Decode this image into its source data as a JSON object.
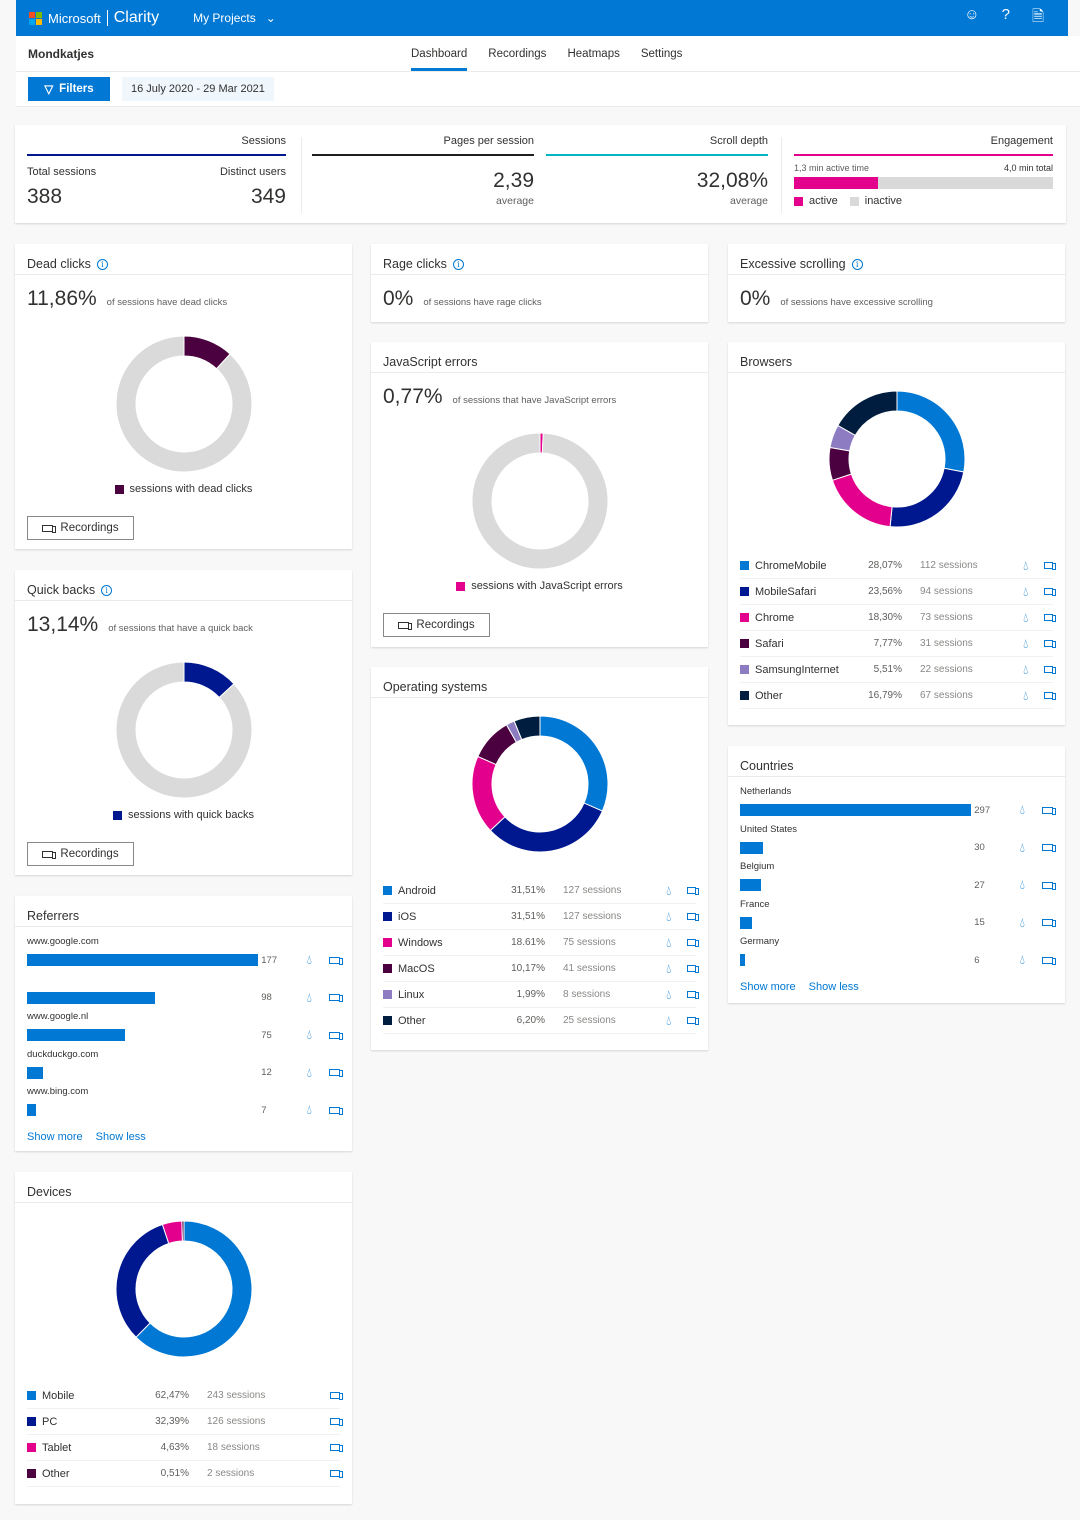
{
  "header": {
    "brand_company": "Microsoft",
    "brand_product": "Clarity",
    "projects_menu": "My Projects",
    "icons": [
      "smiley-icon",
      "help-icon",
      "document-icon"
    ]
  },
  "subnav": {
    "project_name": "Mondkatjes",
    "tabs": [
      {
        "label": "Dashboard",
        "active": true
      },
      {
        "label": "Recordings",
        "active": false
      },
      {
        "label": "Heatmaps",
        "active": false
      },
      {
        "label": "Settings",
        "active": false
      }
    ]
  },
  "filters": {
    "button_label": "Filters",
    "date_range": "16 July 2020 - 29 Mar 2021"
  },
  "colors": {
    "accent": "#0078d4",
    "navy": "#00188f",
    "magenta": "#e3008c",
    "plum": "#4b003f",
    "lavender": "#8e7cc3",
    "dark_navy": "#001d3f",
    "track": "#dadada"
  },
  "summary": {
    "sessions": {
      "header": "Sessions",
      "total_label": "Total sessions",
      "total": "388",
      "distinct_label": "Distinct users",
      "distinct": "349"
    },
    "pages": {
      "header": "Pages per session",
      "value": "2,39",
      "sub": "average"
    },
    "scroll": {
      "header": "Scroll depth",
      "value": "32,08%",
      "sub": "average"
    },
    "engagement": {
      "header": "Engagement",
      "active_label": "1,3 min active time",
      "total_label": "4,0 min total",
      "active_minutes": 1.3,
      "total_minutes": 4.0,
      "legend_active": "active",
      "legend_inactive": "inactive"
    }
  },
  "dead_clicks": {
    "title": "Dead clicks",
    "value": "11,86%",
    "desc": "of sessions have dead clicks",
    "percent": 11.86,
    "legend": "sessions with dead clicks",
    "button": "Recordings"
  },
  "quick_backs": {
    "title": "Quick backs",
    "value": "13,14%",
    "desc": "of sessions that have a quick back",
    "percent": 13.14,
    "legend": "sessions with quick backs",
    "button": "Recordings"
  },
  "rage_clicks": {
    "title": "Rage clicks",
    "value": "0%",
    "desc": "of sessions have rage clicks"
  },
  "excessive_scrolling": {
    "title": "Excessive scrolling",
    "value": "0%",
    "desc": "of sessions have excessive scrolling"
  },
  "js_errors": {
    "title": "JavaScript errors",
    "value": "0,77%",
    "desc": "of sessions that have JavaScript errors",
    "percent": 0.77,
    "legend": "sessions with JavaScript errors",
    "button": "Recordings"
  },
  "browsers": {
    "title": "Browsers",
    "rows": [
      {
        "name": "ChromeMobile",
        "pct": "28,07%",
        "value": 28.07,
        "sessions": "112 sessions",
        "color": "#0078d4"
      },
      {
        "name": "MobileSafari",
        "pct": "23,56%",
        "value": 23.56,
        "sessions": "94 sessions",
        "color": "#00188f"
      },
      {
        "name": "Chrome",
        "pct": "18,30%",
        "value": 18.3,
        "sessions": "73 sessions",
        "color": "#e3008c"
      },
      {
        "name": "Safari",
        "pct": "7,77%",
        "value": 7.77,
        "sessions": "31 sessions",
        "color": "#4b003f"
      },
      {
        "name": "SamsungInternet",
        "pct": "5,51%",
        "value": 5.51,
        "sessions": "22 sessions",
        "color": "#8e7cc3"
      },
      {
        "name": "Other",
        "pct": "16,79%",
        "value": 16.79,
        "sessions": "67 sessions",
        "color": "#001d3f"
      }
    ]
  },
  "operating_systems": {
    "title": "Operating systems",
    "rows": [
      {
        "name": "Android",
        "pct": "31,51%",
        "value": 31.51,
        "sessions": "127 sessions",
        "color": "#0078d4"
      },
      {
        "name": "iOS",
        "pct": "31,51%",
        "value": 31.51,
        "sessions": "127 sessions",
        "color": "#00188f"
      },
      {
        "name": "Windows",
        "pct": "18.61%",
        "value": 18.61,
        "sessions": "75 sessions",
        "color": "#e3008c"
      },
      {
        "name": "MacOS",
        "pct": "10,17%",
        "value": 10.17,
        "sessions": "41 sessions",
        "color": "#4b003f"
      },
      {
        "name": "Linux",
        "pct": "1,99%",
        "value": 1.99,
        "sessions": "8 sessions",
        "color": "#8e7cc3"
      },
      {
        "name": "Other",
        "pct": "6,20%",
        "value": 6.2,
        "sessions": "25 sessions",
        "color": "#001d3f"
      }
    ]
  },
  "devices": {
    "title": "Devices",
    "rows": [
      {
        "name": "Mobile",
        "pct": "62,47%",
        "value": 62.47,
        "sessions": "243 sessions",
        "color": "#0078d4"
      },
      {
        "name": "PC",
        "pct": "32,39%",
        "value": 32.39,
        "sessions": "126 sessions",
        "color": "#00188f"
      },
      {
        "name": "Tablet",
        "pct": "4,63%",
        "value": 4.63,
        "sessions": "18 sessions",
        "color": "#e3008c"
      },
      {
        "name": "Other",
        "pct": "0,51%",
        "value": 0.51,
        "sessions": "2 sessions",
        "color": "#4b003f"
      }
    ]
  },
  "countries": {
    "title": "Countries",
    "items": [
      {
        "label": "Netherlands",
        "value": 297
      },
      {
        "label": "United States",
        "value": 30
      },
      {
        "label": "Belgium",
        "value": 27
      },
      {
        "label": "France",
        "value": 15
      },
      {
        "label": "Germany",
        "value": 6
      }
    ],
    "show_more": "Show more",
    "show_less": "Show less"
  },
  "referrers": {
    "title": "Referrers",
    "items": [
      {
        "label": "www.google.com",
        "value": 177
      },
      {
        "label": "",
        "value": 98
      },
      {
        "label": "www.google.nl",
        "value": 75
      },
      {
        "label": "duckduckgo.com",
        "value": 12
      },
      {
        "label": "www.bing.com",
        "value": 7
      }
    ],
    "show_more": "Show more",
    "show_less": "Show less"
  }
}
